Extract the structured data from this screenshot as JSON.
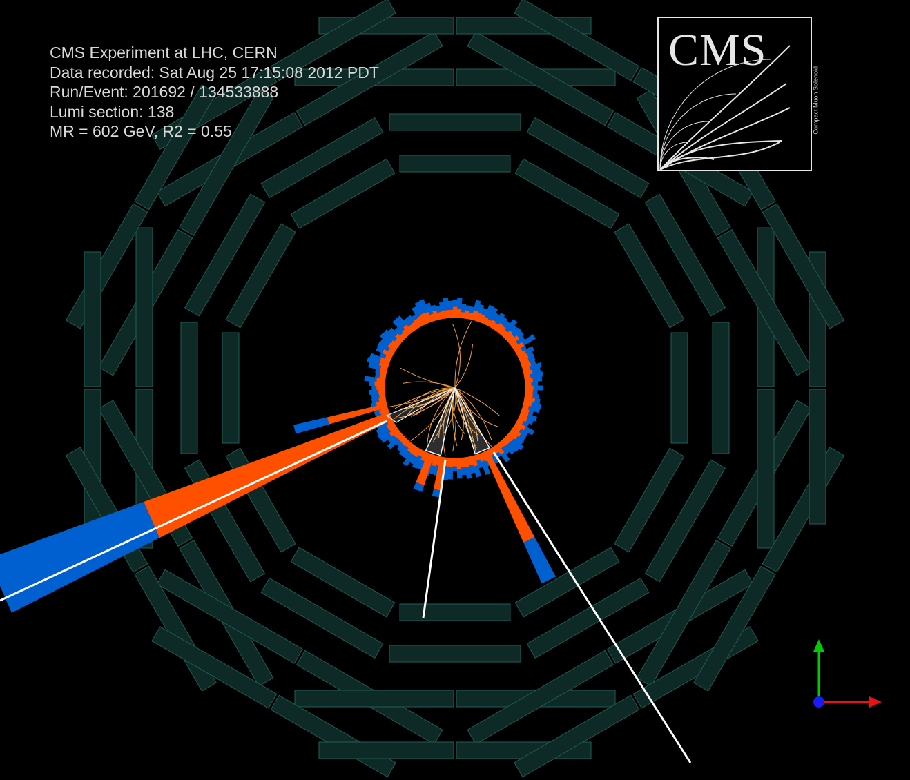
{
  "event_info": {
    "line1": "CMS Experiment at LHC, CERN",
    "line2": "Data recorded: Sat Aug 25 17:15:08 2012 PDT",
    "line3": "Run/Event: 201692 / 134533888",
    "line4": "Lumi section: 138",
    "line5": "MR = 602 GeV, R2 = 0.55"
  },
  "logo": {
    "word": "CMS",
    "subtitle": "Compact Muon Solenoid"
  },
  "colors": {
    "background": "#000000",
    "muon_chamber_fill": "#0e2a26",
    "muon_chamber_stroke": "#1f5d55",
    "ecal": "#ff5000",
    "hcal": "#0060d0",
    "track": "#f0a040",
    "jet_cone": "#f5f5f5",
    "axis_y": "#00cc00",
    "axis_x": "#ee1111",
    "axis_z": "#1a1aff"
  },
  "icons": [
    "cms-logo",
    "axis-triad-icon"
  ]
}
